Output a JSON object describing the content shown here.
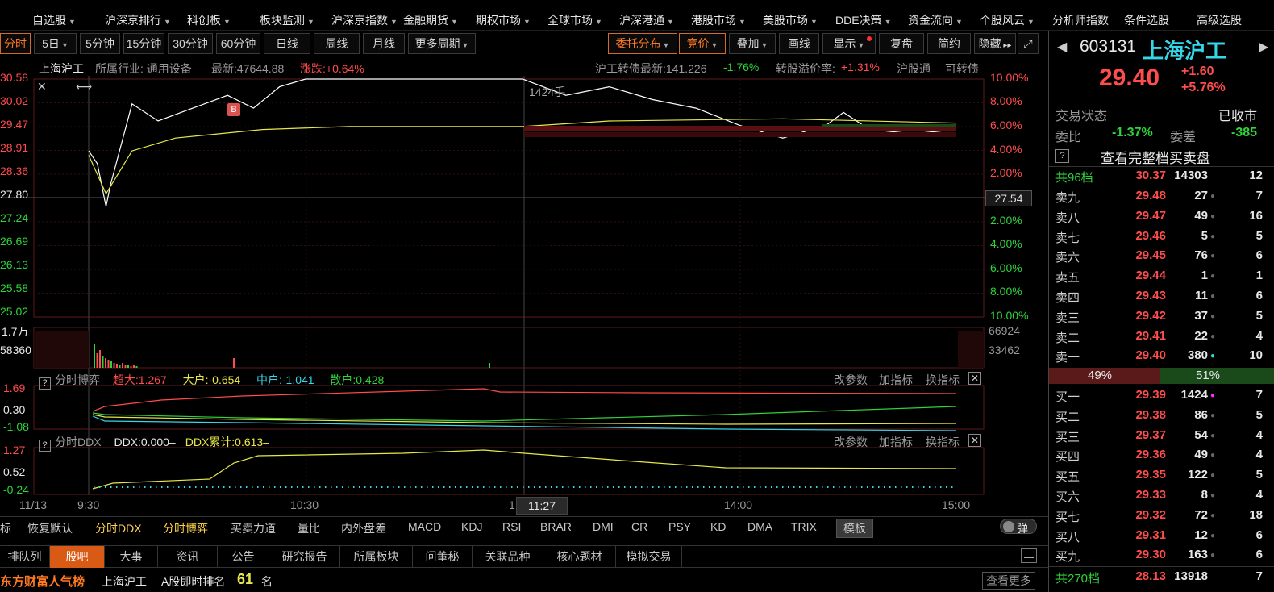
{
  "nav": {
    "items": [
      {
        "label": "自选股",
        "caret": true
      },
      {
        "label": "沪深京排行",
        "caret": true
      },
      {
        "label": "科创板",
        "caret": true
      },
      {
        "label": "板块监测",
        "caret": true
      },
      {
        "label": "沪深京指数",
        "caret": true
      },
      {
        "label": "金融期货",
        "caret": true
      },
      {
        "label": "期权市场",
        "caret": true
      },
      {
        "label": "全球市场",
        "caret": true
      },
      {
        "label": "沪深港通",
        "caret": true
      },
      {
        "label": "港股市场",
        "caret": true
      },
      {
        "label": "美股市场",
        "caret": true
      },
      {
        "label": "DDE决策",
        "caret": true
      },
      {
        "label": "资金流向",
        "caret": true
      },
      {
        "label": "个股风云",
        "caret": true
      },
      {
        "label": "分析师指数",
        "caret": false
      },
      {
        "label": "条件选股",
        "caret": false
      },
      {
        "label": "高级选股",
        "caret": false
      }
    ]
  },
  "toolbar": {
    "periods": [
      "分时",
      "5日",
      "5分钟",
      "15分钟",
      "30分钟",
      "60分钟",
      "日线",
      "周线",
      "月线",
      "更多周期"
    ],
    "right": [
      "委托分布",
      "竞价",
      "叠加",
      "画线",
      "显示",
      "复盘",
      "简约",
      "隐藏"
    ]
  },
  "info": {
    "name": "上海沪工",
    "industry": "所属行业: 通用设备",
    "latest": "最新:47644.88",
    "change": "涨跌:+0.64%",
    "bond": "沪工转债最新:141.226",
    "bond_change": "-1.76%",
    "premium_label": "转股溢价率:",
    "premium": "+1.31%",
    "hgt": "沪股通",
    "kzz": "可转债"
  },
  "chart": {
    "left_ticks": [
      "30.58",
      "30.02",
      "29.47",
      "28.91",
      "28.36",
      "27.80",
      "27.24",
      "26.69",
      "26.13",
      "25.58",
      "25.02"
    ],
    "right_ticks": [
      "10.00%",
      "8.00%",
      "6.00%",
      "4.00%",
      "2.00%",
      "2.00%",
      "4.00%",
      "6.00%",
      "8.00%",
      "10.00%"
    ],
    "base_label": "27.54",
    "annotation": "1424手",
    "b_marker": "B",
    "vol_left": [
      "1.7万",
      "58360"
    ],
    "vol_right": [
      "66924",
      "33462"
    ],
    "time_labels": [
      "11/13",
      "9:30",
      "10:30",
      "11:27",
      "14:00",
      "15:00"
    ],
    "time_prefix": "1"
  },
  "chart_data": {
    "type": "line",
    "x_range": [
      "9:30",
      "15:00"
    ],
    "ylim": [
      25.02,
      30.58
    ],
    "prev_close": 27.8,
    "series": [
      {
        "name": "",
        "points": [
          [
            0,
            28.9
          ],
          [
            0.01,
            28.6
          ],
          [
            0.02,
            27.6
          ],
          [
            0.025,
            28.1
          ],
          [
            0.05,
            30.0
          ],
          [
            0.08,
            29.6
          ],
          [
            0.12,
            29.9
          ],
          [
            0.16,
            30.2
          ],
          [
            0.19,
            29.9
          ],
          [
            0.22,
            30.4
          ],
          [
            0.25,
            30.58
          ],
          [
            0.3,
            30.58
          ],
          [
            0.5,
            30.58
          ],
          [
            0.55,
            30.2
          ],
          [
            0.6,
            30.4
          ],
          [
            0.65,
            30.1
          ],
          [
            0.7,
            29.9
          ],
          [
            0.75,
            29.5
          ],
          [
            0.8,
            29.2
          ],
          [
            0.85,
            29.5
          ],
          [
            0.87,
            29.8
          ],
          [
            0.9,
            29.4
          ],
          [
            0.95,
            29.3
          ],
          [
            1.0,
            29.4
          ]
        ]
      },
      {
        "name": "",
        "points": [
          [
            0,
            28.8
          ],
          [
            0.02,
            27.9
          ],
          [
            0.05,
            28.9
          ],
          [
            0.1,
            29.2
          ],
          [
            0.2,
            29.4
          ],
          [
            0.3,
            29.47
          ],
          [
            0.5,
            29.47
          ],
          [
            0.6,
            29.6
          ],
          [
            0.8,
            29.65
          ],
          [
            1.0,
            29.55
          ]
        ]
      }
    ]
  },
  "panels": {
    "bobo": {
      "title": "分时博弈",
      "items": [
        {
          "label": "超大:1.267–",
          "color": "#ff4c4c"
        },
        {
          "label": "大户:-0.654–",
          "color": "#e8e84a"
        },
        {
          "label": "中户:-1.041–",
          "color": "#35d6e8"
        },
        {
          "label": "散户:0.428–",
          "color": "#2fd33a"
        }
      ],
      "ticks": [
        "1.69",
        "0.30",
        "-1.08"
      ],
      "actions": [
        "改参数",
        "加指标",
        "换指标"
      ]
    },
    "ddx": {
      "title": "分时DDX",
      "items": [
        {
          "label": "DDX:0.000–",
          "color": "#e8e8e8"
        },
        {
          "label": "DDX累计:0.613–",
          "color": "#e8e84a"
        }
      ],
      "ticks": [
        "1.27",
        "0.52",
        "-0.24"
      ],
      "actions": [
        "改参数",
        "加指标",
        "换指标"
      ]
    }
  },
  "indicators": [
    "标",
    "恢复默认",
    "分时DDX",
    "分时博弈",
    "买卖力道",
    "量比",
    "内外盘差",
    "MACD",
    "KDJ",
    "RSI",
    "BRAR",
    "DMI",
    "CR",
    "PSY",
    "KD",
    "DMA",
    "TRIX",
    "模板"
  ],
  "popup": "弹",
  "tabs": [
    "排队列",
    "股吧",
    "大事",
    "资讯",
    "公告",
    "研究报告",
    "所属板块",
    "问董秘",
    "关联品种",
    "核心题材",
    "模拟交易"
  ],
  "rank": {
    "brand": "东方财富人气榜",
    "stock": "上海沪工",
    "label": "A股即时排名",
    "value": "61",
    "unit": "名",
    "more": "查看更多"
  },
  "quote": {
    "code": "603131",
    "name": "上海沪工",
    "price": "29.40",
    "change": "+1.60",
    "pct": "+5.76%",
    "status_label": "交易状态",
    "status": "已收市",
    "wb_label": "委比",
    "wb": "-1.37%",
    "wc_label": "委差",
    "wc": "-385",
    "full_book": "查看完整档买卖盘",
    "ask_total": {
      "label": "共96档",
      "price": "30.37",
      "vol": "14303",
      "cnt": "12"
    },
    "asks": [
      {
        "label": "卖九",
        "price": "29.48",
        "vol": "27",
        "cnt": "7"
      },
      {
        "label": "卖八",
        "price": "29.47",
        "vol": "49",
        "cnt": "16"
      },
      {
        "label": "卖七",
        "price": "29.46",
        "vol": "5",
        "cnt": "5"
      },
      {
        "label": "卖六",
        "price": "29.45",
        "vol": "76",
        "cnt": "6"
      },
      {
        "label": "卖五",
        "price": "29.44",
        "vol": "1",
        "cnt": "1"
      },
      {
        "label": "卖四",
        "price": "29.43",
        "vol": "11",
        "cnt": "6"
      },
      {
        "label": "卖三",
        "price": "29.42",
        "vol": "37",
        "cnt": "5"
      },
      {
        "label": "卖二",
        "price": "29.41",
        "vol": "22",
        "cnt": "4"
      },
      {
        "label": "卖一",
        "price": "29.40",
        "vol": "380",
        "cnt": "10"
      }
    ],
    "ratio": {
      "sell": "49%",
      "buy": "51%",
      "sell_fraction": 0.49
    },
    "bids": [
      {
        "label": "买一",
        "price": "29.39",
        "vol": "1424",
        "cnt": "7"
      },
      {
        "label": "买二",
        "price": "29.38",
        "vol": "86",
        "cnt": "5"
      },
      {
        "label": "买三",
        "price": "29.37",
        "vol": "54",
        "cnt": "4"
      },
      {
        "label": "买四",
        "price": "29.36",
        "vol": "49",
        "cnt": "4"
      },
      {
        "label": "买五",
        "price": "29.35",
        "vol": "122",
        "cnt": "5"
      },
      {
        "label": "买六",
        "price": "29.33",
        "vol": "8",
        "cnt": "4"
      },
      {
        "label": "买七",
        "price": "29.32",
        "vol": "72",
        "cnt": "18"
      },
      {
        "label": "买八",
        "price": "29.31",
        "vol": "12",
        "cnt": "6"
      },
      {
        "label": "买九",
        "price": "29.30",
        "vol": "163",
        "cnt": "6"
      }
    ],
    "bid_total": {
      "label": "共270档",
      "price": "28.13",
      "vol": "13918",
      "cnt": "7"
    }
  },
  "colors": {
    "up": "#ff4c4c",
    "down": "#2fd33a",
    "accent": "#d95a14",
    "price_line": "#ffffff",
    "avg_line": "#e8e84a"
  }
}
